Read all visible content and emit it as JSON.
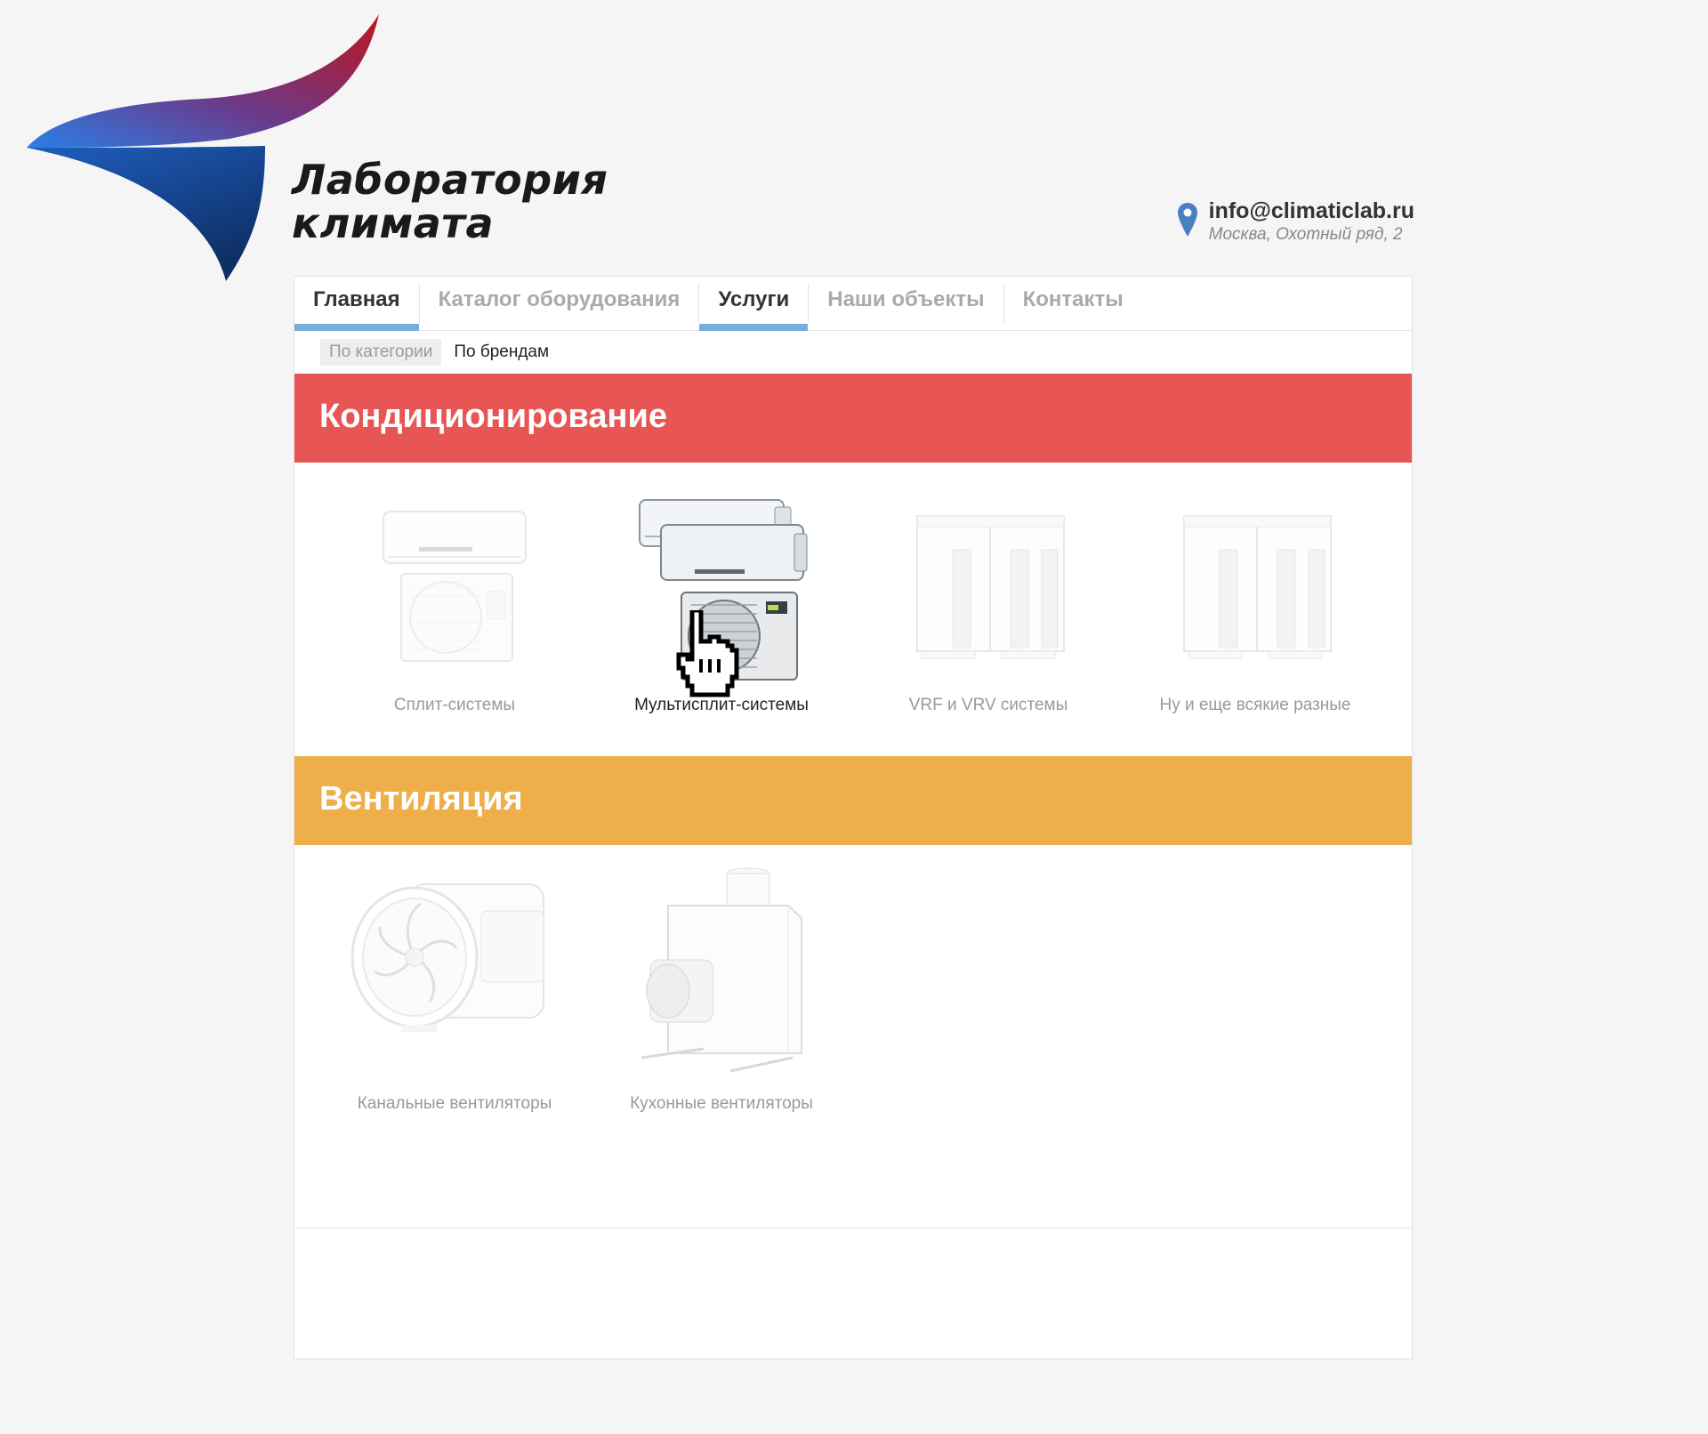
{
  "brand": {
    "name_line1": "Лаборатория",
    "name_line2": "климата",
    "colors": {
      "red": "#c0141e",
      "blue": "#2a7fe8",
      "navy": "#0e3a78"
    }
  },
  "contact": {
    "email": "info@climaticlab.ru",
    "address": "Москва, Охотный ряд, 2",
    "icon": "map-pin-icon"
  },
  "nav": {
    "items": [
      {
        "label": "Главная",
        "active": true
      },
      {
        "label": "Каталог оборудования",
        "active": false
      },
      {
        "label": "Услуги",
        "active": true
      },
      {
        "label": "Наши объекты",
        "active": false
      },
      {
        "label": "Контакты",
        "active": false
      }
    ],
    "accent": "#78aedb"
  },
  "subnav": {
    "by_category": "По категории",
    "by_brand": "По брендам"
  },
  "sections": {
    "conditioning": {
      "title": "Кондиционирование",
      "color": "#e85555",
      "items": [
        {
          "label": "Сплит-системы",
          "icon": "split-system-icon"
        },
        {
          "label": "Мультисплит-системы",
          "icon": "multisplit-system-icon"
        },
        {
          "label": "VRF и VRV системы",
          "icon": "vrf-unit-icon"
        },
        {
          "label": "Ну и еще всякие разные",
          "icon": "vrf-unit-icon"
        }
      ]
    },
    "ventilation": {
      "title": "Вентиляция",
      "color": "#eeae4a",
      "items": [
        {
          "label": "Канальные вентиляторы",
          "icon": "duct-fan-icon"
        },
        {
          "label": "Кухонные вентиляторы",
          "icon": "kitchen-fan-icon"
        }
      ]
    }
  }
}
